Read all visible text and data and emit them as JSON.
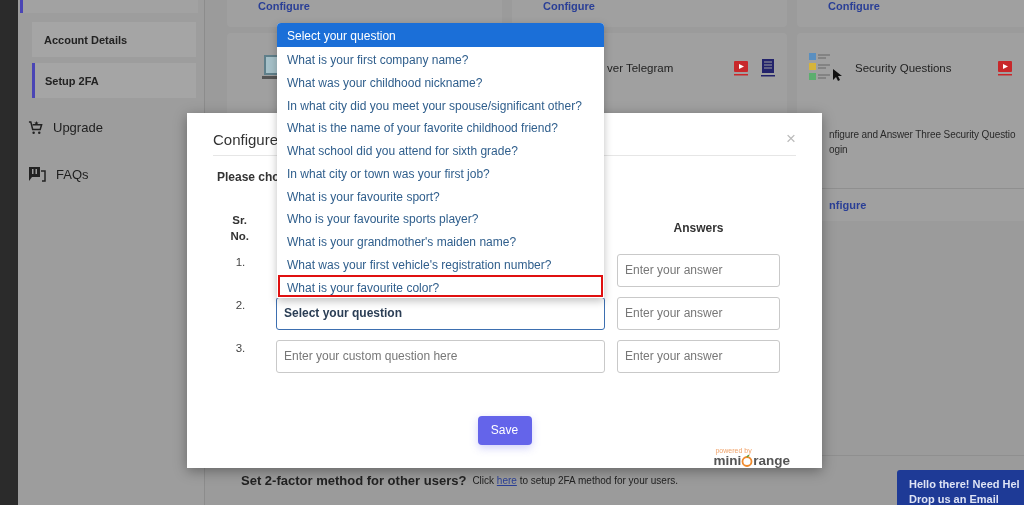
{
  "sidebar": {
    "items": [
      {
        "label": "Account Details",
        "selected": false
      },
      {
        "label": "Setup 2FA",
        "selected": true
      }
    ],
    "links": [
      {
        "kind": "upgrade",
        "label": "Upgrade"
      },
      {
        "kind": "faq",
        "label": "FAQs"
      }
    ]
  },
  "cards_top": [
    {
      "link": "Configure"
    },
    {
      "link": "Configure"
    },
    {
      "link": "Configure"
    }
  ],
  "cards": [
    {
      "kind": "laptop"
    },
    {
      "kind": "telegram",
      "title": "ver Telegram"
    },
    {
      "kind": "questions",
      "title": "Security Questions",
      "description_lines": [
        "nfigure and Answer Three Security Questio",
        "ogin"
      ],
      "link": "nfigure"
    }
  ],
  "footer": {
    "heading": "Set 2-factor method for other users?",
    "before": "Click",
    "link": "here",
    "after": "to setup 2FA method for your users."
  },
  "chat": {
    "lines": [
      "Hello there! Need Hel",
      "Drop us an Email"
    ]
  },
  "modal": {
    "title": "Configure",
    "prompt": "Please cho",
    "close": "×",
    "headers": {
      "number": "Sr. No.",
      "answers": "Answers"
    },
    "rows": [
      {
        "number": "1.",
        "kind": "hidden",
        "answer_placeholder": "Enter your answer"
      },
      {
        "number": "2.",
        "kind": "select",
        "value": "Select your question",
        "focused": true,
        "answer_placeholder": "Enter your answer"
      },
      {
        "number": "3.",
        "kind": "custom",
        "placeholder": "Enter your custom question here",
        "focused": false,
        "answer_placeholder": "Enter your answer"
      }
    ],
    "save": "Save",
    "logo": {
      "caption": "powered by",
      "left": "mini",
      "right": "range"
    }
  },
  "dropdown": {
    "options": [
      {
        "label": "Select your question",
        "selected": true,
        "annotated": false
      },
      {
        "label": "What is your first company name?",
        "selected": false,
        "annotated": false
      },
      {
        "label": "What was your childhood nickname?",
        "selected": false,
        "annotated": false
      },
      {
        "label": "In what city did you meet your spouse/significant other?",
        "selected": false,
        "annotated": false
      },
      {
        "label": "What is the name of your favorite childhood friend?",
        "selected": false,
        "annotated": false
      },
      {
        "label": "What school did you attend for sixth grade?",
        "selected": false,
        "annotated": false
      },
      {
        "label": "In what city or town was your first job?",
        "selected": false,
        "annotated": false
      },
      {
        "label": "What is your favourite sport?",
        "selected": false,
        "annotated": false
      },
      {
        "label": "Who is your favourite sports player?",
        "selected": false,
        "annotated": false
      },
      {
        "label": "What is your grandmother's maiden name?",
        "selected": false,
        "annotated": false
      },
      {
        "label": "What was your first vehicle's registration number?",
        "selected": false,
        "annotated": false
      },
      {
        "label": "What is your favourite color?",
        "selected": false,
        "annotated": true
      }
    ]
  }
}
